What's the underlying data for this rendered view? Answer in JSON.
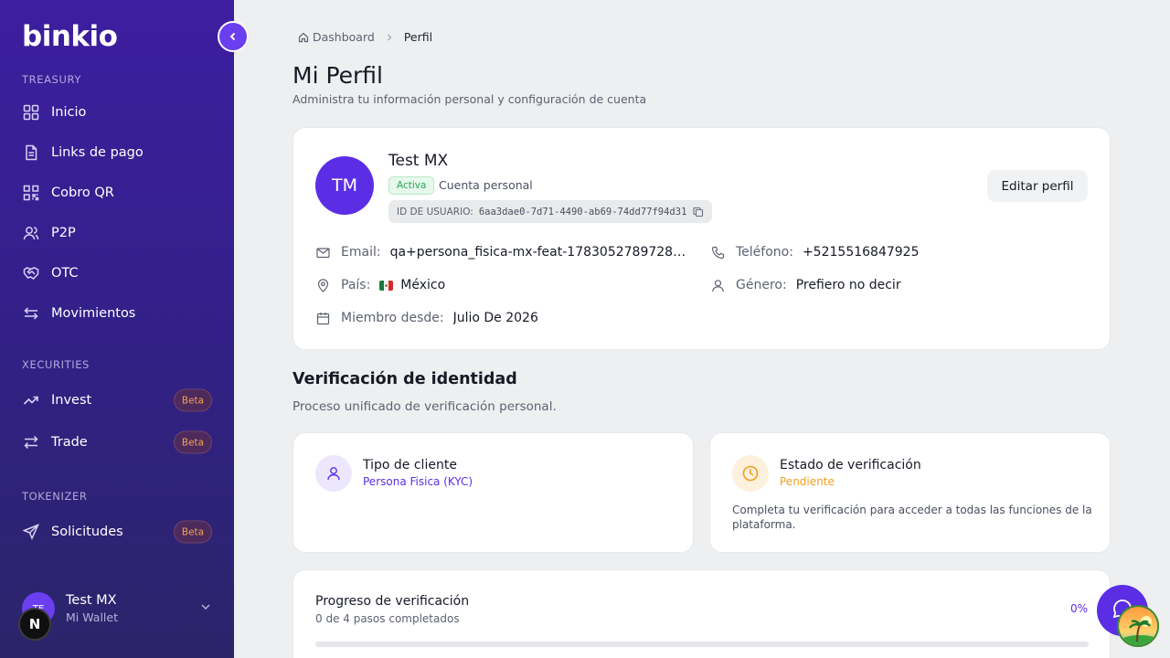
{
  "app": {
    "logo": "binkio"
  },
  "sidebar": {
    "sections": [
      {
        "label": "TREASURY",
        "items": [
          {
            "label": "Inicio",
            "icon": "grid-icon"
          },
          {
            "label": "Links de pago",
            "icon": "document-icon"
          },
          {
            "label": "Cobro QR",
            "icon": "qr-code-icon"
          },
          {
            "label": "P2P",
            "icon": "users-icon"
          },
          {
            "label": "OTC",
            "icon": "handshake-icon"
          },
          {
            "label": "Movimientos",
            "icon": "arrows-left-right-icon"
          }
        ]
      },
      {
        "label": "XECURITIES",
        "items": [
          {
            "label": "Invest",
            "icon": "trending-up-icon",
            "badge": "Beta"
          },
          {
            "label": "Trade",
            "icon": "swap-icon",
            "badge": "Beta"
          }
        ]
      },
      {
        "label": "TOKENIZER",
        "items": [
          {
            "label": "Solicitudes",
            "icon": "send-icon",
            "badge": "Beta"
          }
        ]
      }
    ],
    "user": {
      "initials": "TE",
      "name": "Test MX",
      "subtitle": "Mi Wallet"
    },
    "n_badge": "N"
  },
  "breadcrumb": {
    "home": "Dashboard",
    "current": "Perfil"
  },
  "header": {
    "title": "Mi Perfil",
    "subtitle": "Administra tu información personal y configuración de cuenta"
  },
  "profile": {
    "initials": "TM",
    "name": "Test MX",
    "status": "Activa",
    "account_type": "Cuenta personal",
    "user_id_label": "ID DE USUARIO:",
    "user_id": "6aa3dae0-7d71-4490-ab69-74dd77f94d31",
    "edit_button": "Editar perfil",
    "email_label": "Email:",
    "email": "qa+persona_fisica-mx-feat-1783052789728@...",
    "phone_label": "Teléfono:",
    "phone": "+5215516847925",
    "country_label": "País:",
    "country": "México",
    "gender_label": "Género:",
    "gender": "Prefiero no decir",
    "member_label": "Miembro desde:",
    "member_since": "Julio De 2026"
  },
  "verification": {
    "title": "Verificación de identidad",
    "subtitle": "Proceso unificado de verificación personal.",
    "client_type_title": "Tipo de cliente",
    "client_type_value": "Persona Fisica (KYC)",
    "status_title": "Estado de verificación",
    "status_value": "Pendiente",
    "status_description": "Completa tu verificación para acceder a todas las funciones de la plataforma.",
    "progress_title": "Progreso de verificación",
    "progress_sub": "0 de 4 pasos completados",
    "progress_pct": "0%",
    "progress_fraction": 0
  },
  "colors": {
    "accent": "#5b2ee6",
    "success": "#2aa954",
    "warning": "#f0a01c",
    "beta": "#f0a355"
  }
}
